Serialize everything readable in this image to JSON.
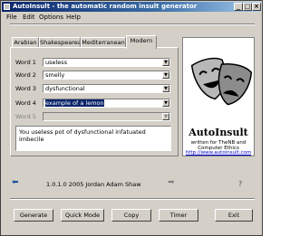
{
  "window": {
    "title": "AutoInsult - the automatic random insult generator",
    "controls": [
      "_",
      "□",
      "×"
    ]
  },
  "menu": [
    {
      "label": "File"
    },
    {
      "label": "Edit"
    },
    {
      "label": "Options"
    },
    {
      "label": "Help"
    }
  ],
  "tabs": [
    {
      "label": "Arabian",
      "active": false
    },
    {
      "label": "Shakespearean",
      "active": false
    },
    {
      "label": "Mediterranean",
      "active": false
    },
    {
      "label": "Modern",
      "active": true
    }
  ],
  "words": [
    {
      "label": "Word 1",
      "value": "useless",
      "enabled": true,
      "selected": false
    },
    {
      "label": "Word 2",
      "value": "smelly",
      "enabled": true,
      "selected": false
    },
    {
      "label": "Word 3",
      "value": "dysfunctional",
      "enabled": true,
      "selected": false
    },
    {
      "label": "Word 4",
      "value": "example of a lemon",
      "enabled": true,
      "selected": true
    },
    {
      "label": "Word 5",
      "value": "",
      "enabled": false,
      "selected": false
    }
  ],
  "output_text": "You useless pot of dysfunctional infatuated imbecile",
  "logo": {
    "brand": "AutoInsult",
    "tagline": "written for TheNB and Computer Ethics",
    "url": "http://www.autoinsult.com"
  },
  "version_text": "1.0.1.0 2005 Jordan Adam Shaw",
  "buttons": {
    "generate": "Generate",
    "quick_mode": "Quick Mode",
    "copy": "Copy",
    "timer": "Timer",
    "exit": "Exit"
  }
}
